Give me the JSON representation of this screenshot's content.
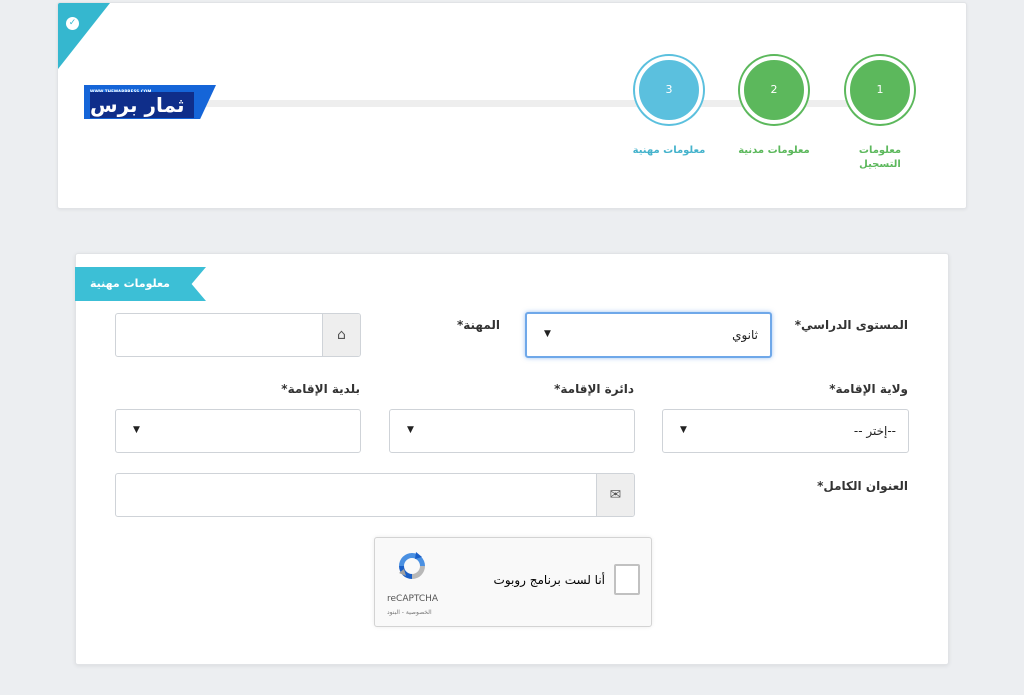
{
  "logo": {
    "small_text": "WWW.THEMARPRESS.COM",
    "text": "ثمار برس"
  },
  "stepper": {
    "steps": [
      {
        "number": "1",
        "label": "معلومات التسجيل",
        "status": "completed"
      },
      {
        "number": "2",
        "label": "معلومات مدنية",
        "status": "completed"
      },
      {
        "number": "3",
        "label": "معلومات مهنية",
        "status": "active"
      }
    ],
    "check_glyph": "✓"
  },
  "section": {
    "title": "معلومات مهنية"
  },
  "form": {
    "education_label": "المستوى الدراسي*",
    "education_value": "ثانوي",
    "profession_label": "المهنة*",
    "profession_value": "",
    "wilaya_label": "ولاية الإقامة*",
    "wilaya_value": "--إختر --",
    "daira_label": "دائرة الإقامة*",
    "daira_value": "",
    "commune_label": "بلدية الإقامة*",
    "commune_value": "",
    "address_label": "العنوان الكامل*",
    "address_value": "",
    "select_arrow": "▼",
    "home_icon": "⌂",
    "envelope_icon": "✉"
  },
  "recaptcha": {
    "label": "أنا لست برنامج روبوت",
    "brand": "reCAPTCHA",
    "terms": "الخصوصية - البنود"
  },
  "colors": {
    "accent": "#3cbfd6",
    "step_completed": "#5cb85c",
    "step_active": "#5bc0de",
    "logo_blue": "#1565d8"
  }
}
